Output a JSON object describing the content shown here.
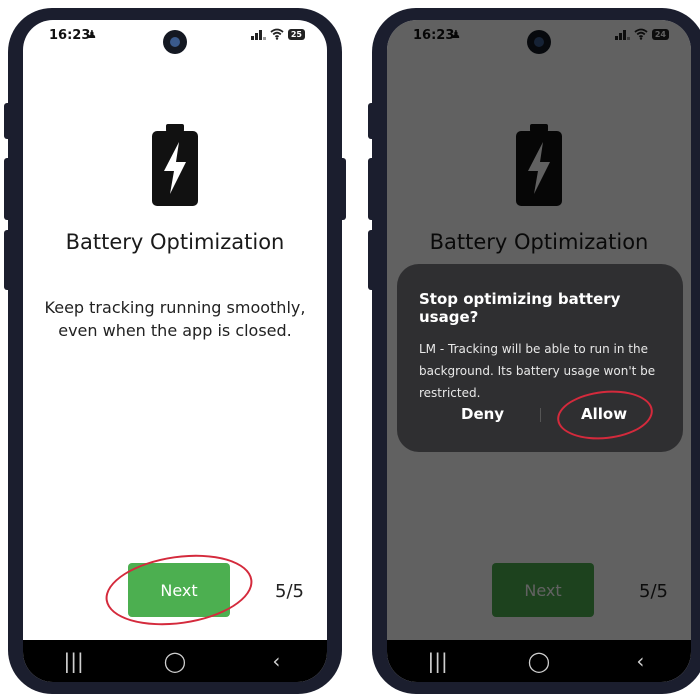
{
  "status_bar": {
    "time": "16:23",
    "battery_left": "25",
    "battery_right": "24"
  },
  "screen": {
    "title": "Battery Optimization",
    "description": "Keep tracking running smoothly, even when the app is closed.",
    "next_label": "Next",
    "page_indicator": "5/5"
  },
  "dialog": {
    "title": "Stop optimizing battery usage?",
    "body": "LM - Tracking will be able to run in the background. Its battery usage won't be restricted.",
    "deny_label": "Deny",
    "allow_label": "Allow"
  },
  "navbar": {
    "recent": "|||",
    "home": "◯",
    "back": "‹"
  },
  "colors": {
    "accent_green": "#4caf50",
    "highlight_red": "#d42a3c",
    "dialog_bg": "#2f2f31"
  },
  "icons": [
    "battery-charging-icon",
    "signal-icon",
    "wifi-icon",
    "battery-icon",
    "person-icon"
  ]
}
